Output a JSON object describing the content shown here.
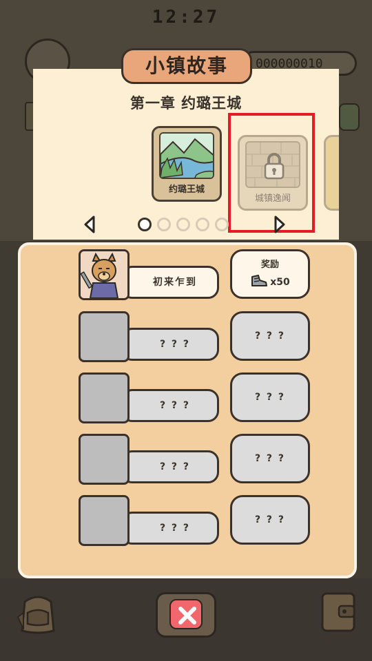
{
  "status_bar": {
    "time": "12:27"
  },
  "hud": {
    "coins": "000000010"
  },
  "story": {
    "title": "小镇故事",
    "chapter": "第一章 约璐王城",
    "cards": [
      {
        "label": "约璐王城",
        "state": "unlocked",
        "icon": "landscape-river-icon"
      },
      {
        "label": "城镇逸闻",
        "state": "locked",
        "icon": "lock-icon"
      }
    ],
    "pagination": {
      "total": 5,
      "current": 1
    }
  },
  "episodes": [
    {
      "name": "初来乍到",
      "unlocked": true,
      "reward_title": "奖励",
      "reward_amount": "x50",
      "reward_icon": "shoe-icon"
    },
    {
      "name": "? ? ?",
      "unlocked": false,
      "reward": "? ? ?"
    },
    {
      "name": "? ? ?",
      "unlocked": false,
      "reward": "? ? ?"
    },
    {
      "name": "? ? ?",
      "unlocked": false,
      "reward": "? ? ?"
    },
    {
      "name": "? ? ?",
      "unlocked": false,
      "reward": "? ? ?"
    }
  ],
  "colors": {
    "panel_bg": "#fcefd4",
    "list_bg": "#f3cfa0",
    "title_plate": "#e9a67a",
    "highlight": "#e51c23",
    "close_button": "#f2676c"
  }
}
